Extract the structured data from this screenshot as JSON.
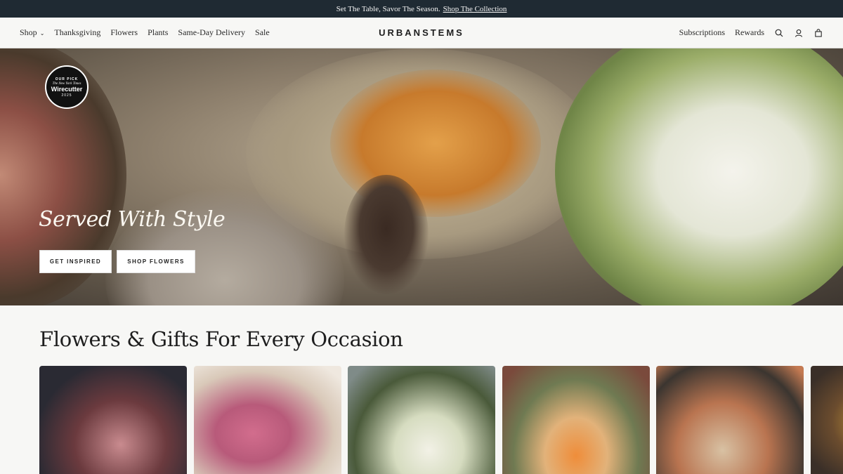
{
  "announcement": {
    "text": "Set The Table, Savor The Season.",
    "link": "Shop The Collection"
  },
  "header": {
    "brand": "URBANSTEMS",
    "nav_left": [
      "Shop",
      "Thanksgiving",
      "Flowers",
      "Plants",
      "Same-Day Delivery",
      "Sale"
    ],
    "nav_right": [
      "Subscriptions",
      "Rewards"
    ],
    "icons": [
      "search-icon",
      "account-icon",
      "cart-icon"
    ]
  },
  "hero": {
    "title": "Served With Style",
    "buttons": [
      "GET INSPIRED",
      "SHOP FLOWERS"
    ],
    "badge": {
      "top": "OUR PICK",
      "publisher": "The New York Times",
      "name": "Wirecutter",
      "year": "2025"
    }
  },
  "occasions": {
    "title": "Flowers & Gifts For Every Occasion"
  },
  "colors": {
    "announcement_bg": "#1f2a33",
    "page_bg": "#f7f7f5",
    "button_bg": "#ffffff"
  }
}
